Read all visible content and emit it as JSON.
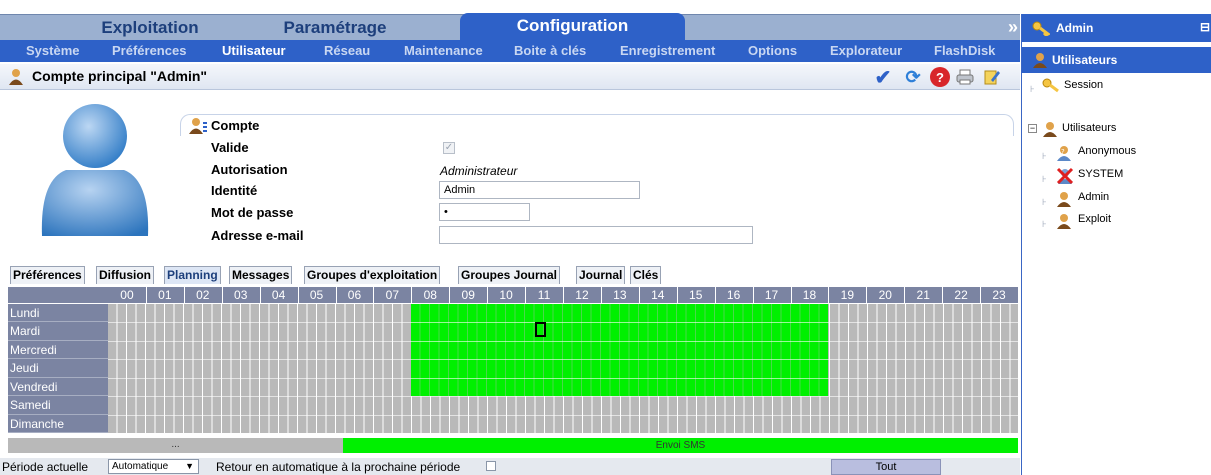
{
  "top_tabs": [
    "Exploitation",
    "Paramétrage",
    "Configuration"
  ],
  "active_top_tab": "Configuration",
  "sub_menu": [
    "Système",
    "Préférences",
    "Utilisateur",
    "Réseau",
    "Maintenance",
    "Boite à clés",
    "Enregistrement",
    "Options",
    "Explorateur",
    "FlashDisk"
  ],
  "active_sub_menu": "Utilisateur",
  "title": "Compte principal \"Admin\"",
  "compte": {
    "section_title": "Compte",
    "valide_label": "Valide",
    "autorisation_label": "Autorisation",
    "autorisation_value": "Administrateur",
    "identite_label": "Identité",
    "identite_value": "Admin",
    "mot_de_passe_label": "Mot de passe",
    "mot_de_passe_value": "•",
    "email_label": "Adresse e-mail",
    "email_value": ""
  },
  "tabs": [
    "Préférences",
    "Diffusion",
    "Planning",
    "Messages",
    "Groupes d'exploitation",
    "Groupes Journal",
    "Journal",
    "Clés"
  ],
  "active_tab": "Planning",
  "planning": {
    "hours": [
      "00",
      "01",
      "02",
      "03",
      "04",
      "05",
      "06",
      "07",
      "08",
      "09",
      "10",
      "11",
      "12",
      "13",
      "14",
      "15",
      "16",
      "17",
      "18",
      "19",
      "20",
      "21",
      "22",
      "23"
    ],
    "days": [
      "Lundi",
      "Mardi",
      "Mercredi",
      "Jeudi",
      "Vendredi",
      "Samedi",
      "Dimanche"
    ],
    "active_days": [
      "Lundi",
      "Mardi",
      "Mercredi",
      "Jeudi",
      "Vendredi"
    ],
    "active_start_hour": 8,
    "active_end_hour": 19,
    "selected_day": "Mardi",
    "selected_hour": 11.25,
    "left_band_label": "...",
    "sms_band_label": "Envoi SMS"
  },
  "bottom": {
    "periode_label": "Période actuelle",
    "periode_value": "Automatique",
    "retour_label": "Retour en automatique à la prochaine période",
    "tout_button": "Tout"
  },
  "sidebar": {
    "header1": "Admin",
    "header2": "Utilisateurs",
    "session": "Session",
    "users_group": "Utilisateurs",
    "users": [
      "Anonymous",
      "SYSTEM",
      "Admin",
      "Exploit"
    ]
  },
  "colors": {
    "accent": "#2e61c8",
    "active_cell": "#00f000",
    "inactive_cell": "#b9b9b9",
    "grid_header": "#7b84a2"
  }
}
